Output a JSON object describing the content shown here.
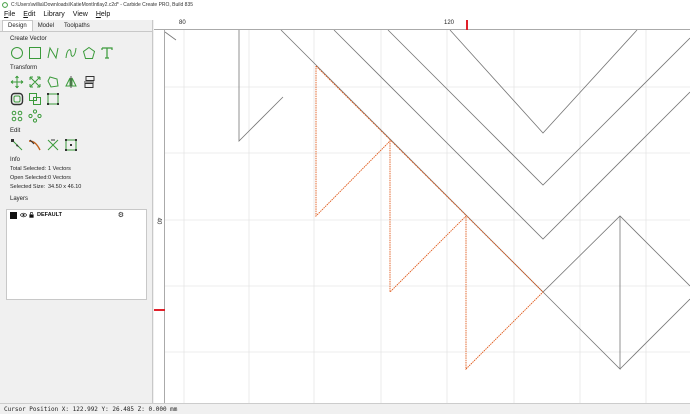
{
  "window": {
    "title": "C:\\Users\\willia\\Downloads\\KatieMontIntlay2.c2d* - Carbide Create PRO, Build 835"
  },
  "menu": [
    {
      "label": "File",
      "u": "F",
      "rest": "ile"
    },
    {
      "label": "Edit",
      "u": "E",
      "rest": "dit"
    },
    {
      "label": "Library",
      "u": "",
      "rest": "Library"
    },
    {
      "label": "View",
      "u": "",
      "rest": "View"
    },
    {
      "label": "Help",
      "u": "H",
      "rest": "elp"
    }
  ],
  "tabs": {
    "design": "Design",
    "model": "Model",
    "toolpaths": "Toolpaths"
  },
  "sections": {
    "create_vector": "Create Vector",
    "transform": "Transform",
    "edit": "Edit",
    "info": "Info",
    "layers": "Layers"
  },
  "info": {
    "total_selected_label": "Total Selected:",
    "total_selected_value": "1 Vectors",
    "open_selected_label": "Open Selected:",
    "open_selected_value": "0 Vectors",
    "selected_size_label": "Selected Size:",
    "selected_size_value": "34.50 x 46.10"
  },
  "layers": [
    {
      "name": "DEFAULT"
    }
  ],
  "ruler": {
    "h_labels": [
      "80",
      "120"
    ],
    "v_labels": [
      "40"
    ]
  },
  "status": {
    "cursor": "Cursor Position X: 122.992 Y: 26.485 Z: 0.000 mm"
  },
  "colors": {
    "accent_green": "#3a9a3a",
    "selection_orange": "#e05a1a",
    "ruler_marker_red": "#e0202a"
  },
  "icons": {
    "create": [
      "circle-icon",
      "rectangle-icon",
      "polyline-icon",
      "curve-icon",
      "polygon-icon",
      "text-icon"
    ],
    "transform1": [
      "move-icon",
      "resize-icon",
      "rotate-icon",
      "mirror-icon",
      "align-icon"
    ],
    "transform2": [
      "offset-icon",
      "boolean-icon",
      "join-icon"
    ],
    "transform3": [
      "array-icon",
      "circular-array-icon"
    ],
    "edit": [
      "node-edit-icon",
      "trim-icon",
      "cut-icon",
      "box-select-icon"
    ]
  }
}
